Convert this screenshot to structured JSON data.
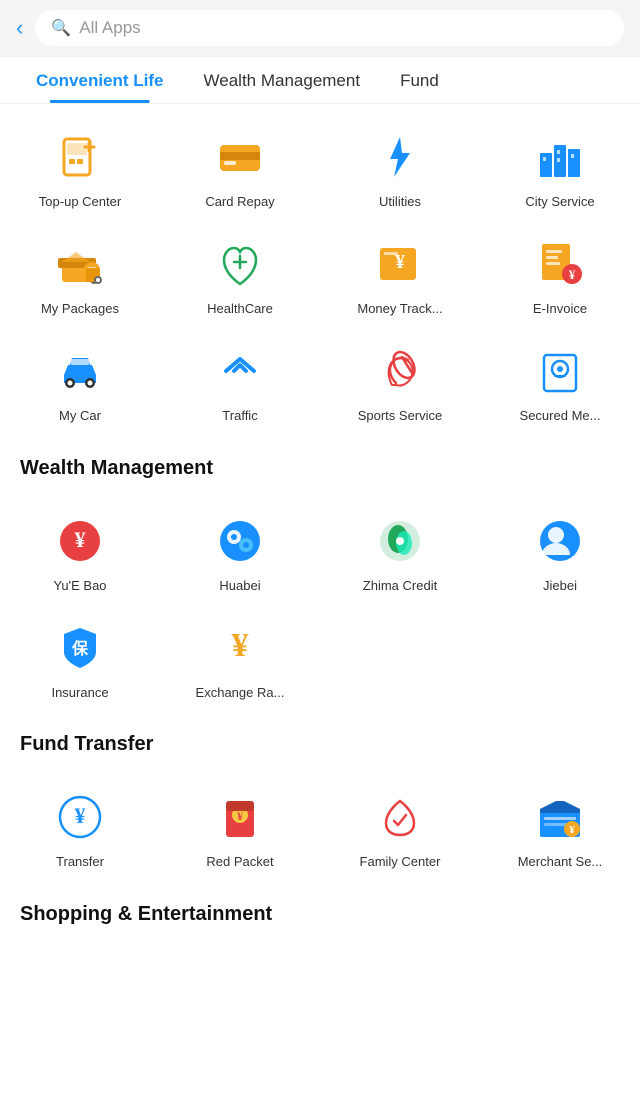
{
  "search": {
    "placeholder": "All Apps"
  },
  "tabs": [
    {
      "id": "convenient-life",
      "label": "Convenient Life",
      "active": true
    },
    {
      "id": "wealth-management",
      "label": "Wealth Management",
      "active": false
    },
    {
      "id": "fund",
      "label": "Fund",
      "active": false
    }
  ],
  "sections": [
    {
      "id": "convenient-life-apps",
      "showHeader": false,
      "apps": [
        {
          "id": "top-up-center",
          "label": "Top-up Center",
          "icon": "topup",
          "color": "#f5a623"
        },
        {
          "id": "card-repay",
          "label": "Card Repay",
          "icon": "card",
          "color": "#f5a623"
        },
        {
          "id": "utilities",
          "label": "Utilities",
          "icon": "utilities",
          "color": "#1890ff"
        },
        {
          "id": "city-service",
          "label": "City Service",
          "icon": "city",
          "color": "#1890ff"
        },
        {
          "id": "my-packages",
          "label": "My Packages",
          "icon": "packages",
          "color": "#f5a623"
        },
        {
          "id": "healthcare",
          "label": "HealthCare",
          "icon": "healthcare",
          "color": "#22a85a"
        },
        {
          "id": "money-track",
          "label": "Money Track...",
          "icon": "moneytrack",
          "color": "#f5a623"
        },
        {
          "id": "e-invoice",
          "label": "E-Invoice",
          "icon": "einvoice",
          "color": "#f5a623"
        },
        {
          "id": "my-car",
          "label": "My Car",
          "icon": "car",
          "color": "#1890ff"
        },
        {
          "id": "traffic",
          "label": "Traffic",
          "icon": "traffic",
          "color": "#1890ff"
        },
        {
          "id": "sports-service",
          "label": "Sports Service",
          "icon": "sports",
          "color": "#e84040"
        },
        {
          "id": "secured-me",
          "label": "Secured Me...",
          "icon": "secured",
          "color": "#1890ff"
        }
      ]
    },
    {
      "id": "wealth-management-section",
      "showHeader": true,
      "header": "Wealth Management",
      "apps": [
        {
          "id": "yue-bao",
          "label": "Yu'E Bao",
          "icon": "yuebao",
          "color": "#e84040"
        },
        {
          "id": "huabei",
          "label": "Huabei",
          "icon": "huabei",
          "color": "#1890ff"
        },
        {
          "id": "zhima-credit",
          "label": "Zhima Credit",
          "icon": "zhima",
          "color": "#22a85a"
        },
        {
          "id": "jiebei",
          "label": "Jiebei",
          "icon": "jiebei",
          "color": "#1890ff"
        },
        {
          "id": "insurance",
          "label": "Insurance",
          "icon": "insurance",
          "color": "#1890ff"
        },
        {
          "id": "exchange-rate",
          "label": "Exchange Ra...",
          "icon": "exchange",
          "color": "#f5a623"
        }
      ]
    },
    {
      "id": "fund-transfer-section",
      "showHeader": true,
      "header": "Fund Transfer",
      "apps": [
        {
          "id": "transfer",
          "label": "Transfer",
          "icon": "transfer",
          "color": "#1890ff"
        },
        {
          "id": "red-packet",
          "label": "Red Packet",
          "icon": "redpacket",
          "color": "#e84040"
        },
        {
          "id": "family-center",
          "label": "Family Center",
          "icon": "family",
          "color": "#e84040"
        },
        {
          "id": "merchant-se",
          "label": "Merchant Se...",
          "icon": "merchant",
          "color": "#1890ff"
        }
      ]
    },
    {
      "id": "shopping-section",
      "showHeader": true,
      "header": "Shopping & Entertainment",
      "apps": []
    }
  ]
}
